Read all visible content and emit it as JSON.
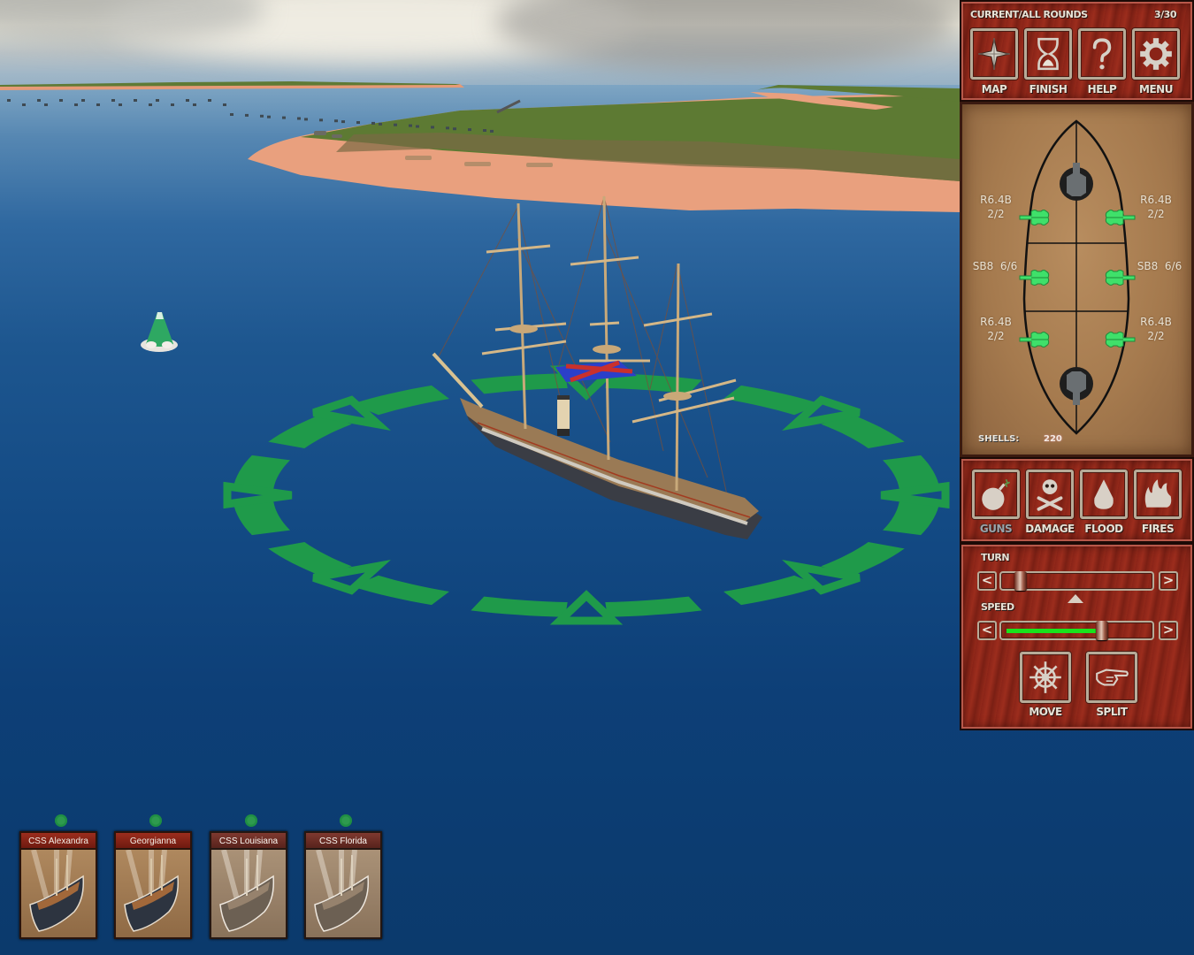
{
  "hud": {
    "rounds_label": "CURRENT/ALL ROUNDS",
    "rounds_value": "3/30",
    "top_buttons": [
      {
        "label": "MAP",
        "icon": "compass-star-icon"
      },
      {
        "label": "FINISH",
        "icon": "hourglass-icon"
      },
      {
        "label": "HELP",
        "icon": "question-mark-icon"
      },
      {
        "label": "MENU",
        "icon": "gear-icon"
      }
    ]
  },
  "ship_diagram": {
    "guns": [
      {
        "side": "port",
        "row": 1,
        "type": "R6.4B",
        "count": "2/2"
      },
      {
        "side": "starboard",
        "row": 1,
        "type": "R6.4B",
        "count": "2/2"
      },
      {
        "side": "port",
        "row": 2,
        "type": "SB8",
        "count": "6/6"
      },
      {
        "side": "starboard",
        "row": 2,
        "type": "SB8",
        "count": "6/6"
      },
      {
        "side": "port",
        "row": 3,
        "type": "R6.4B",
        "count": "2/2"
      },
      {
        "side": "starboard",
        "row": 3,
        "type": "R6.4B",
        "count": "2/2"
      }
    ],
    "gun_labels": {
      "r1_port": "R6.4B\n2/2",
      "r1_star": "R6.4B\n2/2",
      "r2_port": "SB8  6/6",
      "r2_star": "SB8  6/6",
      "r3_port": "R6.4B\n2/2",
      "r3_star": "R6.4B\n2/2"
    },
    "shells_label": "SHELLS:",
    "shells_value": "220",
    "gun_ready_color": "#3fe06a",
    "pivot_gun_color": "#6a6f72"
  },
  "status_buttons": [
    {
      "label": "GUNS",
      "icon": "bomb-icon"
    },
    {
      "label": "DAMAGE",
      "icon": "skull-crossbones-icon"
    },
    {
      "label": "FLOOD",
      "icon": "water-drop-icon"
    },
    {
      "label": "FIRES",
      "icon": "flames-icon"
    }
  ],
  "controls": {
    "turn_label": "TURN",
    "turn_value": 0.03,
    "turn_left": "<",
    "turn_right": ">",
    "speed_label": "SPEED",
    "speed_value": 0.68,
    "speed_left": "<",
    "speed_right": ">",
    "speed_fill_color": "#19e31c",
    "actions": [
      {
        "label": "MOVE",
        "icon": "ship-wheel-icon"
      },
      {
        "label": "SPLIT",
        "icon": "pointing-hand-icon"
      }
    ]
  },
  "fleet": [
    {
      "name": "CSS Alexandra",
      "selected": true
    },
    {
      "name": "Georgianna",
      "selected": true
    },
    {
      "name": "CSS Louisiana",
      "selected": false
    },
    {
      "name": "CSS Florida",
      "selected": false
    }
  ],
  "scene": {
    "movement_ring_color": "#1f9a4a",
    "sea_color": "#0d3f77",
    "sand_color": "#e9a07e",
    "grass_color": "#5d7a33",
    "buoy_color": "#2ea862"
  }
}
